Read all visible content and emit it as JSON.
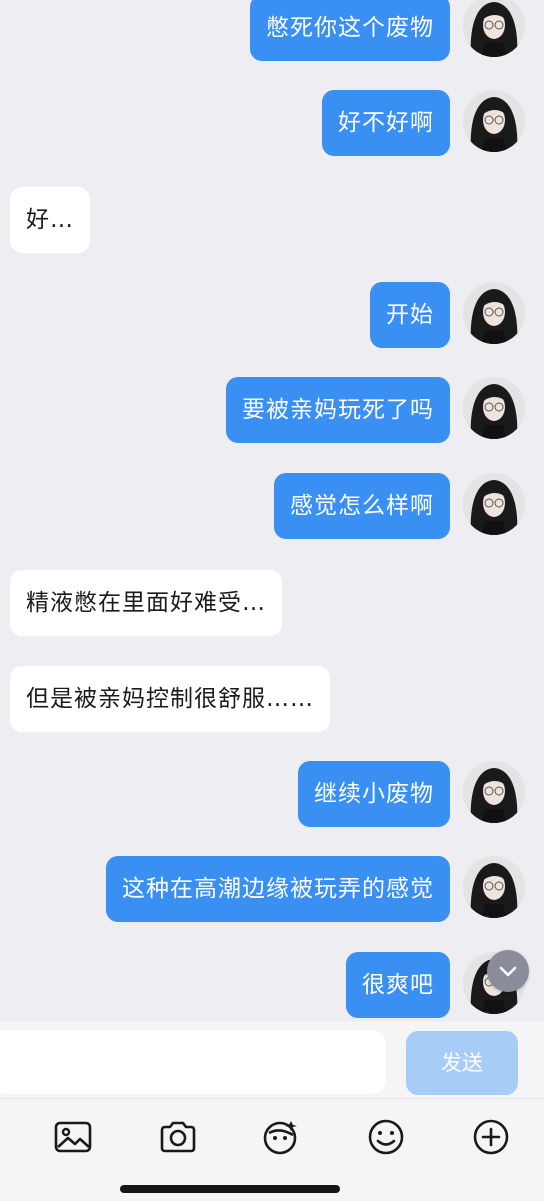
{
  "messages": [
    {
      "side": "out",
      "text": "憋死你这个废物"
    },
    {
      "side": "out",
      "text": "好不好啊"
    },
    {
      "side": "in",
      "text": "好…"
    },
    {
      "side": "out",
      "text": "开始"
    },
    {
      "side": "out",
      "text": "要被亲妈玩死了吗"
    },
    {
      "side": "out",
      "text": "感觉怎么样啊"
    },
    {
      "side": "in",
      "text": "精液憋在里面好难受…"
    },
    {
      "side": "in",
      "text": "但是被亲妈控制很舒服……"
    },
    {
      "side": "out",
      "text": "继续小废物"
    },
    {
      "side": "out",
      "text": "这种在高潮边缘被玩弄的感觉"
    },
    {
      "side": "out",
      "text": "很爽吧"
    }
  ],
  "input": {
    "value": "",
    "placeholder": ""
  },
  "send_label": "发送",
  "icons": {
    "scroll_down": "chevron-down-icon",
    "toolbar": [
      "image-icon",
      "camera-icon",
      "sticker-icon",
      "emoji-icon",
      "plus-circle-icon"
    ]
  },
  "colors": {
    "outgoing_bubble": "#3a8ff3",
    "incoming_bubble": "#ffffff",
    "background": "#ededf2",
    "send_disabled": "#a7cdf7"
  }
}
